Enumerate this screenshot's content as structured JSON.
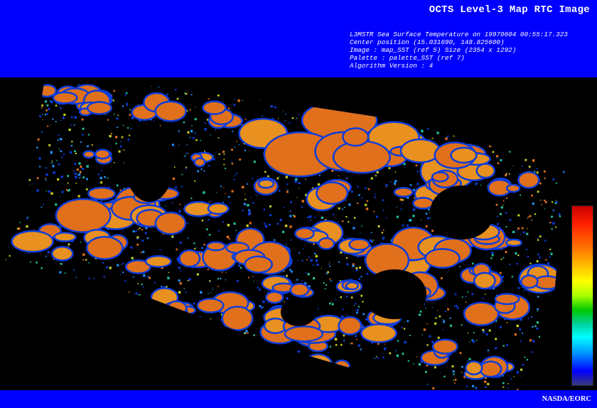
{
  "header": {
    "title": "OCTS Level-3 Map RTC Image",
    "meta_lines": [
      "L3MSTR Sea Surface Temperature on 19970604 00:55:17.323",
      "Center position (15.031690, 148.825600)",
      "Image : map_SST (ref 5) Size (2354 x 1292)",
      "Palette : palette_SST (ref 7)",
      "Algorithm Version : 4"
    ]
  },
  "colors": {
    "banner": "#0000fe",
    "background": "#000000",
    "text": "#ffffff",
    "data_main": "#e0701c",
    "data_warm": "#e89020",
    "data_edge": "#0a3cdc"
  },
  "legend": {
    "palette": [
      "#c80000",
      "#ff7800",
      "#ffff00",
      "#00c800",
      "#00ffff",
      "#0000ff",
      "#3a3a78"
    ]
  },
  "footer": {
    "credit": "NASDA/EORC"
  }
}
